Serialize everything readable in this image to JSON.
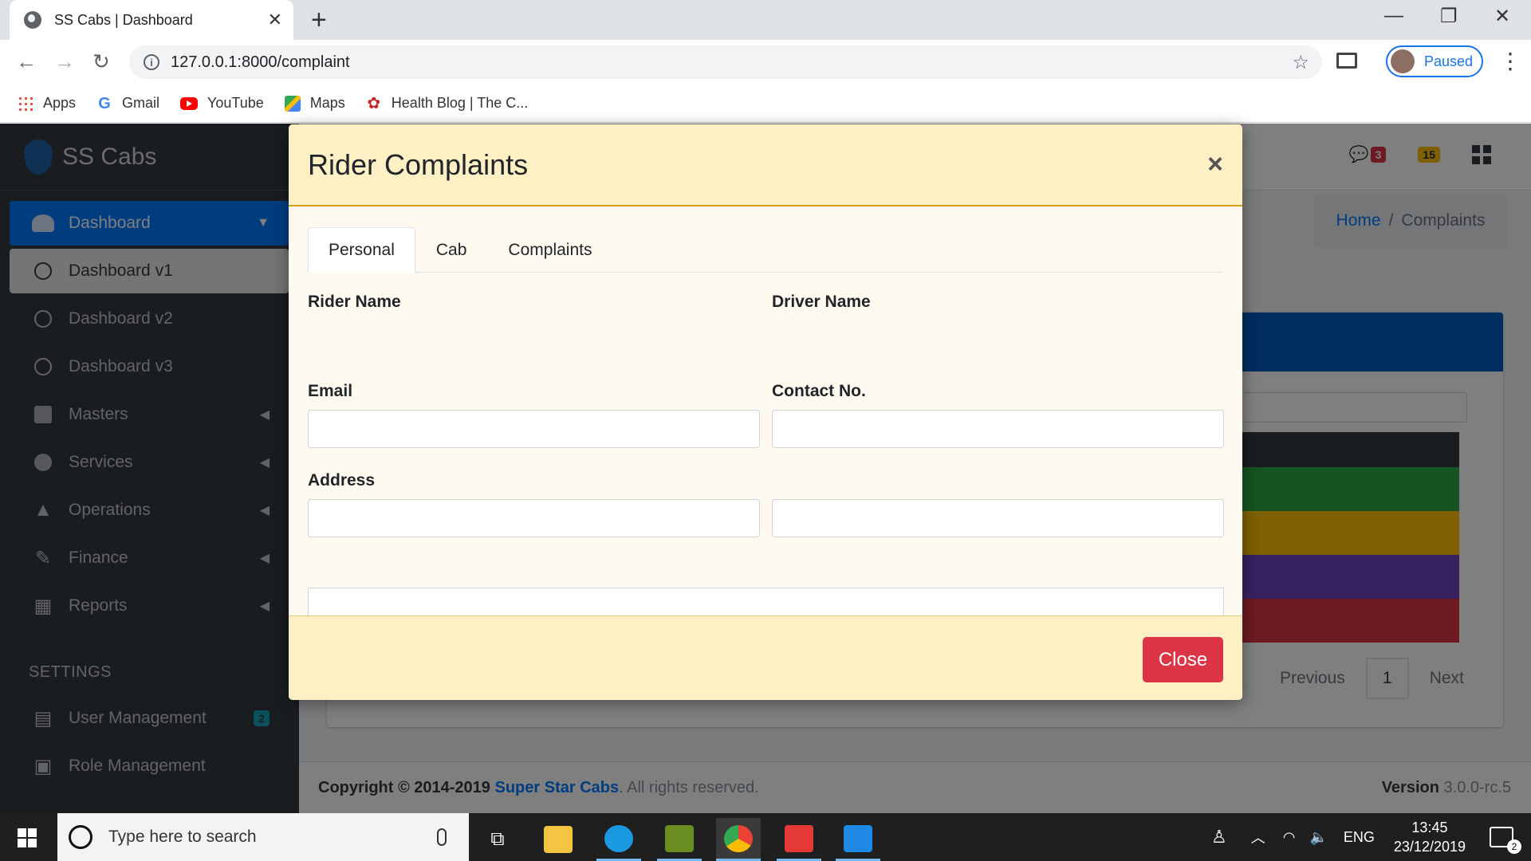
{
  "browser": {
    "tab_title": "SS Cabs | Dashboard",
    "url": "127.0.0.1:8000/complaint",
    "profile_label": "Paused",
    "bookmarks": [
      {
        "label": "Apps",
        "icon": "apps-icon"
      },
      {
        "label": "Gmail",
        "icon": "gmail-icon"
      },
      {
        "label": "YouTube",
        "icon": "youtube-icon"
      },
      {
        "label": "Maps",
        "icon": "maps-icon"
      },
      {
        "label": "Health Blog | The C...",
        "icon": "health-icon"
      }
    ]
  },
  "sidebar": {
    "brand": "SS Cabs",
    "items": [
      {
        "label": "Dashboard",
        "icon": "dashboard-icon"
      },
      {
        "label": "Dashboard v1",
        "icon": "circle-icon"
      },
      {
        "label": "Dashboard v2",
        "icon": "circle-icon"
      },
      {
        "label": "Dashboard v3",
        "icon": "circle-icon"
      },
      {
        "label": "Masters",
        "icon": "copy-icon"
      },
      {
        "label": "Services",
        "icon": "pie-chart-icon"
      },
      {
        "label": "Operations",
        "icon": "tree-icon"
      },
      {
        "label": "Finance",
        "icon": "edit-icon"
      },
      {
        "label": "Reports",
        "icon": "table-icon"
      }
    ],
    "settings_header": "SETTINGS",
    "settings_items": [
      {
        "label": "User Management",
        "badge": "2",
        "icon": "calendar-icon"
      },
      {
        "label": "Role Management",
        "icon": "image-icon"
      }
    ]
  },
  "header": {
    "messages_count": "3",
    "notifications_count": "15"
  },
  "breadcrumb": {
    "home": "Home",
    "current": "Complaints"
  },
  "pagination": {
    "previous": "Previous",
    "page": "1",
    "next": "Next"
  },
  "footer": {
    "copyright_prefix": "Copyright © 2014-2019",
    "company": "Super Star Cabs",
    "rights": ". All rights reserved.",
    "version_label": "Version",
    "version": "3.0.0-rc.5"
  },
  "modal": {
    "title": "Rider Complaints",
    "close_x": "×",
    "tabs": [
      {
        "label": "Personal",
        "active": true
      },
      {
        "label": "Cab",
        "active": false
      },
      {
        "label": "Complaints",
        "active": false
      }
    ],
    "fields": {
      "rider_name_label": "Rider Name",
      "rider_name_value": "",
      "driver_name_label": "Driver Name",
      "driver_name_value": "",
      "email_label": "Email",
      "email_value": "",
      "contact_label": "Contact No.",
      "contact_value": "",
      "address_label": "Address",
      "address_value": ""
    },
    "close_button": "Close"
  },
  "taskbar": {
    "search_placeholder": "Type here to search",
    "language": "ENG",
    "time": "13:45",
    "date": "23/12/2019",
    "notification_count": "2"
  },
  "colors": {
    "primary": "#007bff",
    "sidebar_bg": "#343a40",
    "modal_header_bg": "#fdf0c4",
    "close_button": "#dc3545",
    "row_green": "#28a745",
    "row_yellow": "#ffc107",
    "row_purple": "#6f42c1",
    "row_red": "#dc3545"
  }
}
